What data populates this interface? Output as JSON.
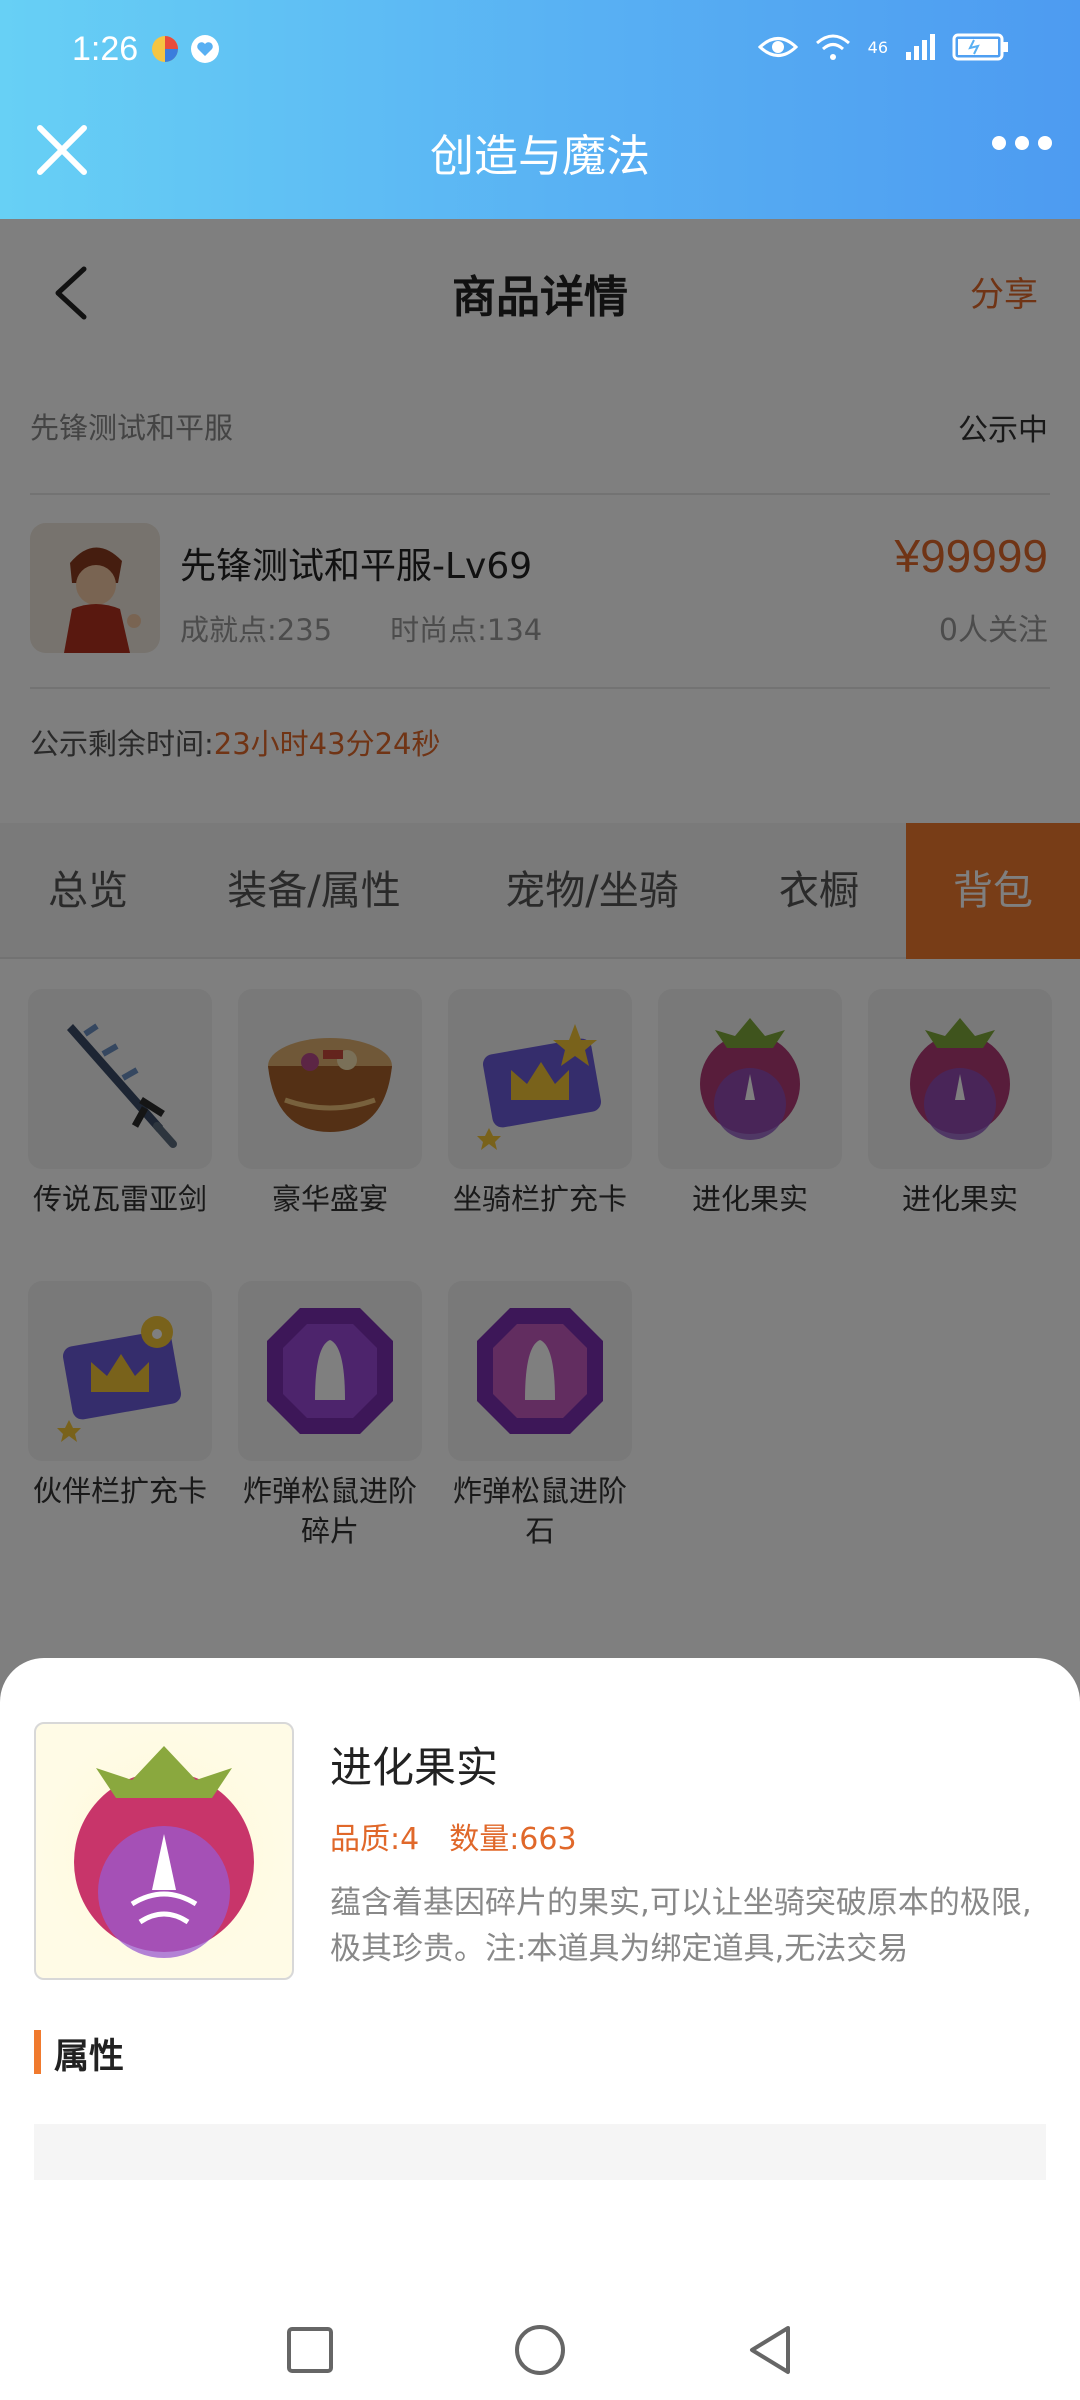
{
  "status_bar": {
    "time": "1:26",
    "network": "46"
  },
  "title_bar": {
    "title": "创造与魔法"
  },
  "header": {
    "title": "商品详情",
    "share": "分享"
  },
  "listing": {
    "server": "先锋测试和平服",
    "state": "公示中",
    "character_name": "先锋测试和平服-Lv69",
    "price": "¥99999",
    "achievement": "成就点:235",
    "fashion": "时尚点:134",
    "followers": "0人关注",
    "remaining_label": "公示剩余时间:",
    "remaining_value": "23小时43分24秒"
  },
  "tabs": [
    {
      "label": "总览"
    },
    {
      "label": "装备/属性"
    },
    {
      "label": "宠物/坐骑"
    },
    {
      "label": "衣橱"
    },
    {
      "label": "背包",
      "active": true
    }
  ],
  "items": [
    {
      "name": "传说瓦雷亚剑",
      "icon": "sword-icon"
    },
    {
      "name": "豪华盛宴",
      "icon": "feast-bowl-icon"
    },
    {
      "name": "坐骑栏扩充卡",
      "icon": "crown-card-icon"
    },
    {
      "name": "进化果实",
      "icon": "raspberry-icon"
    },
    {
      "name": "进化果实",
      "icon": "raspberry-icon"
    },
    {
      "name": "伙伴栏扩充卡",
      "icon": "paw-crown-card-icon"
    },
    {
      "name": "炸弹松鼠进阶碎片",
      "icon": "purple-gem-icon"
    },
    {
      "name": "炸弹松鼠进阶石",
      "icon": "purple-gem-icon"
    }
  ],
  "sheet": {
    "name": "进化果实",
    "quality": "品质:4",
    "quantity": "数量:663",
    "description": "蕴含着基因碎片的果实,可以让坐骑突破原本的极限,极其珍贵。注:本道具为绑定道具,无法交易",
    "section_title": "属性"
  },
  "colors": {
    "accent": "#f07a2e",
    "price": "#e0682a",
    "topbar": "#58b0f3"
  }
}
